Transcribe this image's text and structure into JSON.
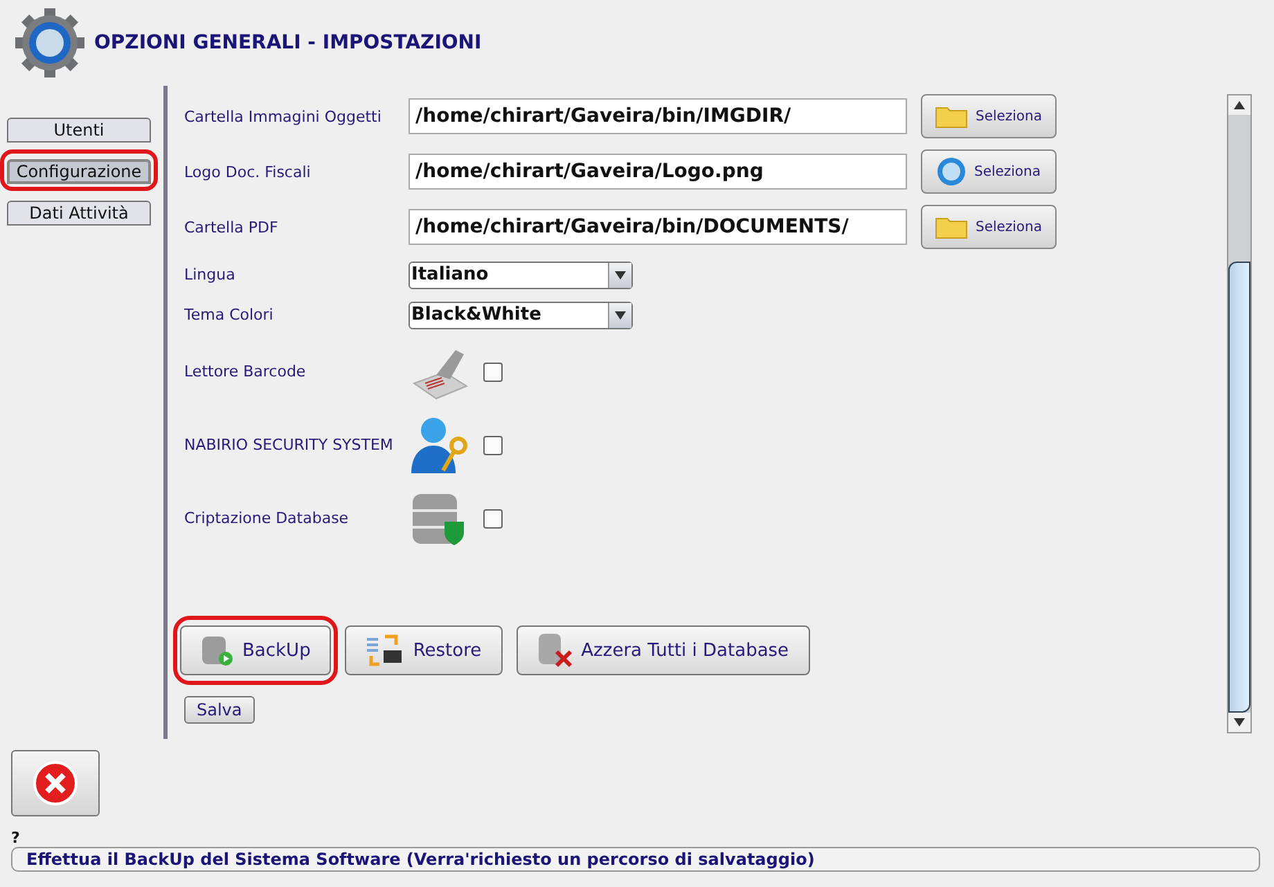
{
  "window": {
    "title": "OPZIONI GENERALI - IMPOSTAZIONI"
  },
  "tabs": [
    {
      "label": "Utenti",
      "selected": false,
      "highlighted": false
    },
    {
      "label": "Configurazione",
      "selected": true,
      "highlighted": true
    },
    {
      "label": "Dati Attività",
      "selected": false,
      "highlighted": false
    }
  ],
  "settings": [
    {
      "kind": "folder",
      "label": "Cartella Immagini Oggetti",
      "value": "/home/chirart/Gaveira/bin/IMGDIR/",
      "button": "Seleziona"
    },
    {
      "kind": "logo",
      "label": "Logo Doc. Fiscali",
      "value": "/home/chirart/Gaveira/Logo.png",
      "button": "Seleziona"
    },
    {
      "kind": "folder",
      "label": "Cartella PDF",
      "value": "/home/chirart/Gaveira/bin/DOCUMENTS/",
      "button": "Seleziona"
    },
    {
      "kind": "select",
      "label": "Lingua",
      "value": "Italiano"
    },
    {
      "kind": "select",
      "label": "Tema Colori",
      "value": "Black&White"
    },
    {
      "kind": "scanner",
      "label": "Lettore Barcode",
      "checked": false
    },
    {
      "kind": "security",
      "label": "NABIRIO SECURITY SYSTEM",
      "checked": false
    },
    {
      "kind": "database",
      "label": "Criptazione Database",
      "checked": false
    }
  ],
  "actions": [
    {
      "kind": "backup",
      "label": "BackUp",
      "highlighted": true
    },
    {
      "kind": "restore",
      "label": "Restore",
      "highlighted": false
    },
    {
      "kind": "reset",
      "label": "Azzera Tutti i Database",
      "highlighted": false
    }
  ],
  "save_button": "Salva",
  "help_mark": "?",
  "status_text": "Effettua il BackUp del Sistema Software (Verra'richiesto un percorso di salvataggio)"
}
